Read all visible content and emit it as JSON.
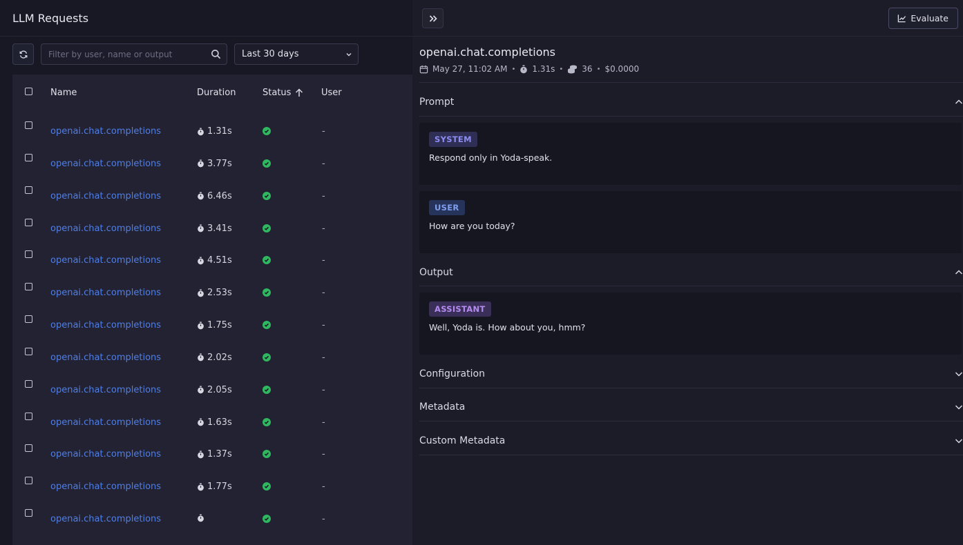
{
  "left": {
    "title": "LLM Requests",
    "search_placeholder": "Filter by user, name or output",
    "range": "Last 30 days",
    "columns": {
      "name": "Name",
      "duration": "Duration",
      "status": "Status",
      "user": "User"
    },
    "rows": [
      {
        "name": "openai.chat.completions",
        "duration": "1.31s",
        "user": "-"
      },
      {
        "name": "openai.chat.completions",
        "duration": "3.77s",
        "user": "-"
      },
      {
        "name": "openai.chat.completions",
        "duration": "6.46s",
        "user": "-"
      },
      {
        "name": "openai.chat.completions",
        "duration": "3.41s",
        "user": "-"
      },
      {
        "name": "openai.chat.completions",
        "duration": "4.51s",
        "user": "-"
      },
      {
        "name": "openai.chat.completions",
        "duration": "2.53s",
        "user": "-"
      },
      {
        "name": "openai.chat.completions",
        "duration": "1.75s",
        "user": "-"
      },
      {
        "name": "openai.chat.completions",
        "duration": "2.02s",
        "user": "-"
      },
      {
        "name": "openai.chat.completions",
        "duration": "2.05s",
        "user": "-"
      },
      {
        "name": "openai.chat.completions",
        "duration": "1.63s",
        "user": "-"
      },
      {
        "name": "openai.chat.completions",
        "duration": "1.37s",
        "user": "-"
      },
      {
        "name": "openai.chat.completions",
        "duration": "1.77s",
        "user": "-"
      },
      {
        "name": "openai.chat.completions",
        "duration": "",
        "user": "-"
      }
    ]
  },
  "right": {
    "evaluate_label": "Evaluate",
    "title": "openai.chat.completions",
    "meta": {
      "date": "May 27, 11:02 AM",
      "duration": "1.31s",
      "tokens": "36",
      "cost": "$0.0000"
    },
    "prompt_label": "Prompt",
    "system_role": "SYSTEM",
    "system_text": "Respond only in Yoda-speak.",
    "user_role": "USER",
    "user_text": "How are you today?",
    "output_label": "Output",
    "assistant_role": "ASSISTANT",
    "assistant_text": "Well, Yoda is. How about you, hmm?",
    "configuration_label": "Configuration",
    "metadata_label": "Metadata",
    "custom_metadata_label": "Custom Metadata"
  },
  "colors": {
    "link": "#4f7fe8",
    "success": "#2fb85f",
    "system": "#8c8cf2",
    "user": "#7f9ef0",
    "assistant": "#b58bef"
  },
  "icons": [
    "refresh-icon",
    "search-icon",
    "chevron-down-icon",
    "sort-ascending-icon",
    "stopwatch-icon",
    "check-circle-icon",
    "double-chevron-right-icon",
    "chart-line-icon",
    "calendar-icon",
    "coins-icon",
    "chevron-up-icon"
  ]
}
